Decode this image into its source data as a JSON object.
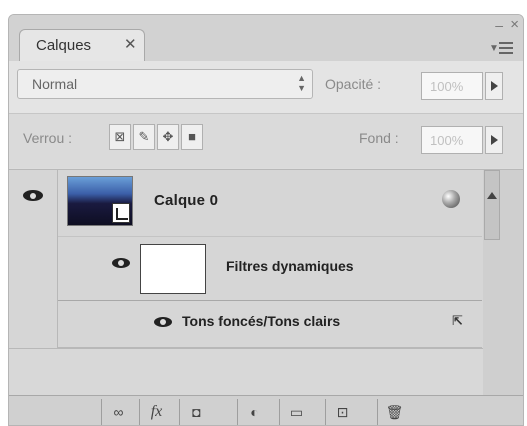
{
  "panel": {
    "tab_label": "Calques",
    "tab_close": "✕",
    "window_minimize": "–",
    "window_close": "×"
  },
  "blend_mode": {
    "value": "Normal",
    "stepper": "▲▼"
  },
  "opacity": {
    "label": "Opacité :",
    "value": "100%"
  },
  "lock": {
    "label": "Verrou :",
    "icons": [
      "lock-transparent-pixels-icon",
      "lock-image-pixels-icon",
      "lock-position-icon",
      "lock-all-icon"
    ]
  },
  "fill": {
    "label": "Fond :",
    "value": "100%"
  },
  "layers": [
    {
      "name": "Calque 0",
      "type": "smart-object",
      "visible": true
    },
    {
      "name": "Filtres dynamiques",
      "type": "smart-filter-mask",
      "visible": true
    },
    {
      "name": "Tons foncés/Tons clairs",
      "type": "smart-filter",
      "visible": true,
      "options_icon": "filter-blending-options-icon"
    }
  ],
  "toolbar": {
    "buttons": [
      {
        "name": "link-layers-icon",
        "glyph": "∞"
      },
      {
        "name": "layer-style-fx-icon",
        "glyph": "fx"
      },
      {
        "name": "add-mask-icon",
        "glyph": "◘"
      },
      {
        "name": "adjustment-layer-icon",
        "glyph": "◐"
      },
      {
        "name": "new-group-icon",
        "glyph": "▭"
      },
      {
        "name": "new-layer-icon",
        "glyph": "⊡"
      },
      {
        "name": "trash-icon",
        "glyph": "🗑"
      }
    ]
  }
}
